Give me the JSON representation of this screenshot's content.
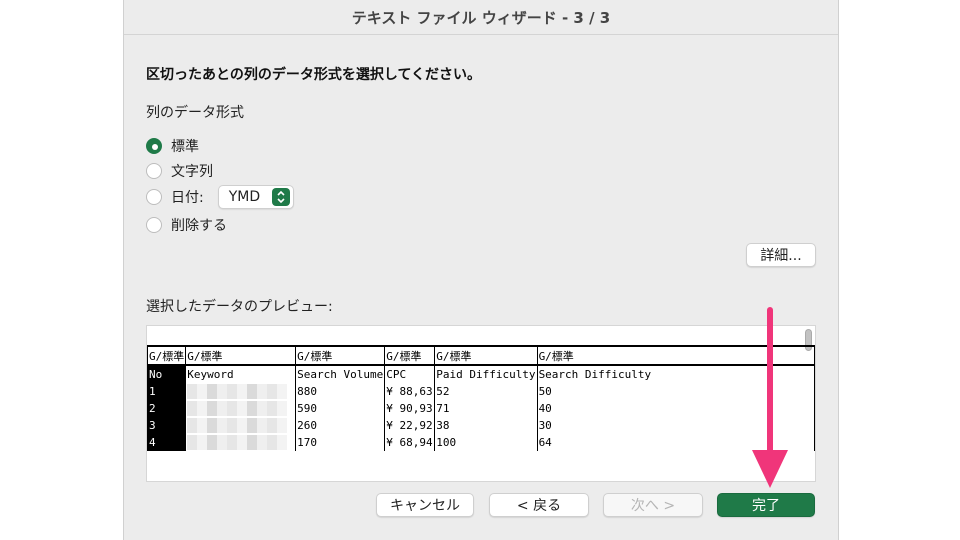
{
  "window": {
    "title": "テキスト ファイル ウィザード - 3 / 3"
  },
  "heading": "区切ったあとの列のデータ形式を選択してください。",
  "format_section": {
    "label": "列のデータ形式",
    "options": [
      {
        "label": "標準",
        "selected": true
      },
      {
        "label": "文字列",
        "selected": false
      },
      {
        "label": "日付:",
        "selected": false
      },
      {
        "label": "削除する",
        "selected": false
      }
    ],
    "date_format": "YMD"
  },
  "advanced_button": "詳細...",
  "preview": {
    "label": "選択したデータのプレビュー:",
    "format_row": [
      "G/標準",
      "G/標準",
      "G/標準",
      "G/標準",
      "G/標準",
      "G/標準"
    ],
    "header_row": [
      "No",
      "Keyword",
      "Search Volume",
      "CPC",
      "Paid Difficulty",
      "Search Difficulty"
    ],
    "rows": [
      [
        "1",
        "",
        "880",
        "¥ 88,63",
        "52",
        "50"
      ],
      [
        "2",
        "",
        "590",
        "¥ 90,93",
        "71",
        "40"
      ],
      [
        "3",
        "",
        "260",
        "¥ 22,92",
        "38",
        "30"
      ],
      [
        "4",
        "",
        "170",
        "¥ 68,94",
        "100",
        "64"
      ]
    ]
  },
  "buttons": {
    "cancel": "キャンセル",
    "back": "< 戻る",
    "next": "次へ >",
    "finish": "完了"
  },
  "colors": {
    "accent": "#1f7a48",
    "annotation_arrow": "#f0357a"
  },
  "annotation": {
    "type": "arrow",
    "points_to": "finish-button"
  }
}
